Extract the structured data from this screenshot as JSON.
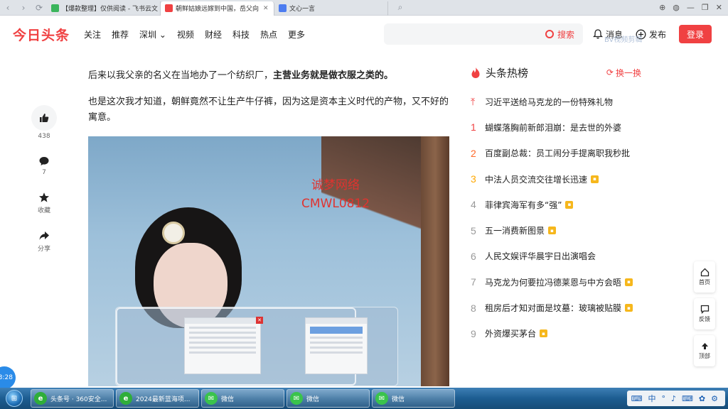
{
  "browser": {
    "tabs": [
      {
        "label": "【爆款整理】仅供阅读 - 飞书云文",
        "color": "#3bb55c"
      },
      {
        "label": "朝鲜姑娘远嫁到中国，岳父向",
        "color": "#f04142",
        "active": true
      },
      {
        "label": "文心一言",
        "color": "#4c7cf0"
      }
    ]
  },
  "header": {
    "logo": "今日头条",
    "nav": [
      "关注",
      "推荐",
      "深圳",
      "视频",
      "财经",
      "科技",
      "热点",
      "更多"
    ],
    "search_label": "搜索",
    "messages": "消息",
    "publish": "发布",
    "login": "登录",
    "top_watermark": "BV视频剪辑"
  },
  "sidebar": {
    "like_count": "438",
    "comment_count": "7",
    "favorite_label": "收藏",
    "share_label": "分享"
  },
  "article": {
    "p1_plain": "后来以我父亲的名义在当地办了一个纺织厂，",
    "p1_bold": "主营业务就是做衣服之类的。",
    "p2": "也是这次我才知道，朝鲜竟然不让生产牛仔裤，因为这是资本主义时代的产物，又不好的寓意。",
    "watermark_line1": "诚梦网络",
    "watermark_line2": "CMWL0812"
  },
  "hot": {
    "title": "头条热榜",
    "refresh": "换一换",
    "items": [
      {
        "rank": "",
        "text": "习近平送给马克龙的一份特殊礼物",
        "badge": false
      },
      {
        "rank": "1",
        "text": "蝴蝶落胸前新郎泪崩：是去世的外婆",
        "badge": false
      },
      {
        "rank": "2",
        "text": "百度副总裁：员工闹分手提离职我秒批",
        "badge": false
      },
      {
        "rank": "3",
        "text": "中法人员交流交往增长迅速",
        "badge": true
      },
      {
        "rank": "4",
        "text": "菲律宾海军有多“强”",
        "badge": true
      },
      {
        "rank": "5",
        "text": "五一消费新图景",
        "badge": true
      },
      {
        "rank": "6",
        "text": "人民文娱评华晨宇日出演唱会",
        "badge": false
      },
      {
        "rank": "7",
        "text": "马克龙为何要拉冯德莱恩与中方会晤",
        "badge": true
      },
      {
        "rank": "8",
        "text": "租房后才知对面是坟墓：玻璃被贴膜",
        "badge": true
      },
      {
        "rank": "9",
        "text": "外资爆买茅台",
        "badge": true
      }
    ]
  },
  "float": {
    "home": "首页",
    "feedback": "反馈",
    "top": "顶部"
  },
  "clock": "3:28",
  "taskbar": {
    "items": [
      {
        "label": "头条号 · 360安全...",
        "color": "#2fae3a",
        "glyph": "e"
      },
      {
        "label": "2024最新蓝海项...",
        "color": "#2fae3a",
        "glyph": "e"
      },
      {
        "label": "微信",
        "color": "#3ac34c",
        "glyph": "✉"
      },
      {
        "label": "微信",
        "color": "#3ac34c",
        "glyph": "✉"
      },
      {
        "label": "微信",
        "color": "#3ac34c",
        "glyph": "✉"
      }
    ],
    "ime": "中"
  }
}
